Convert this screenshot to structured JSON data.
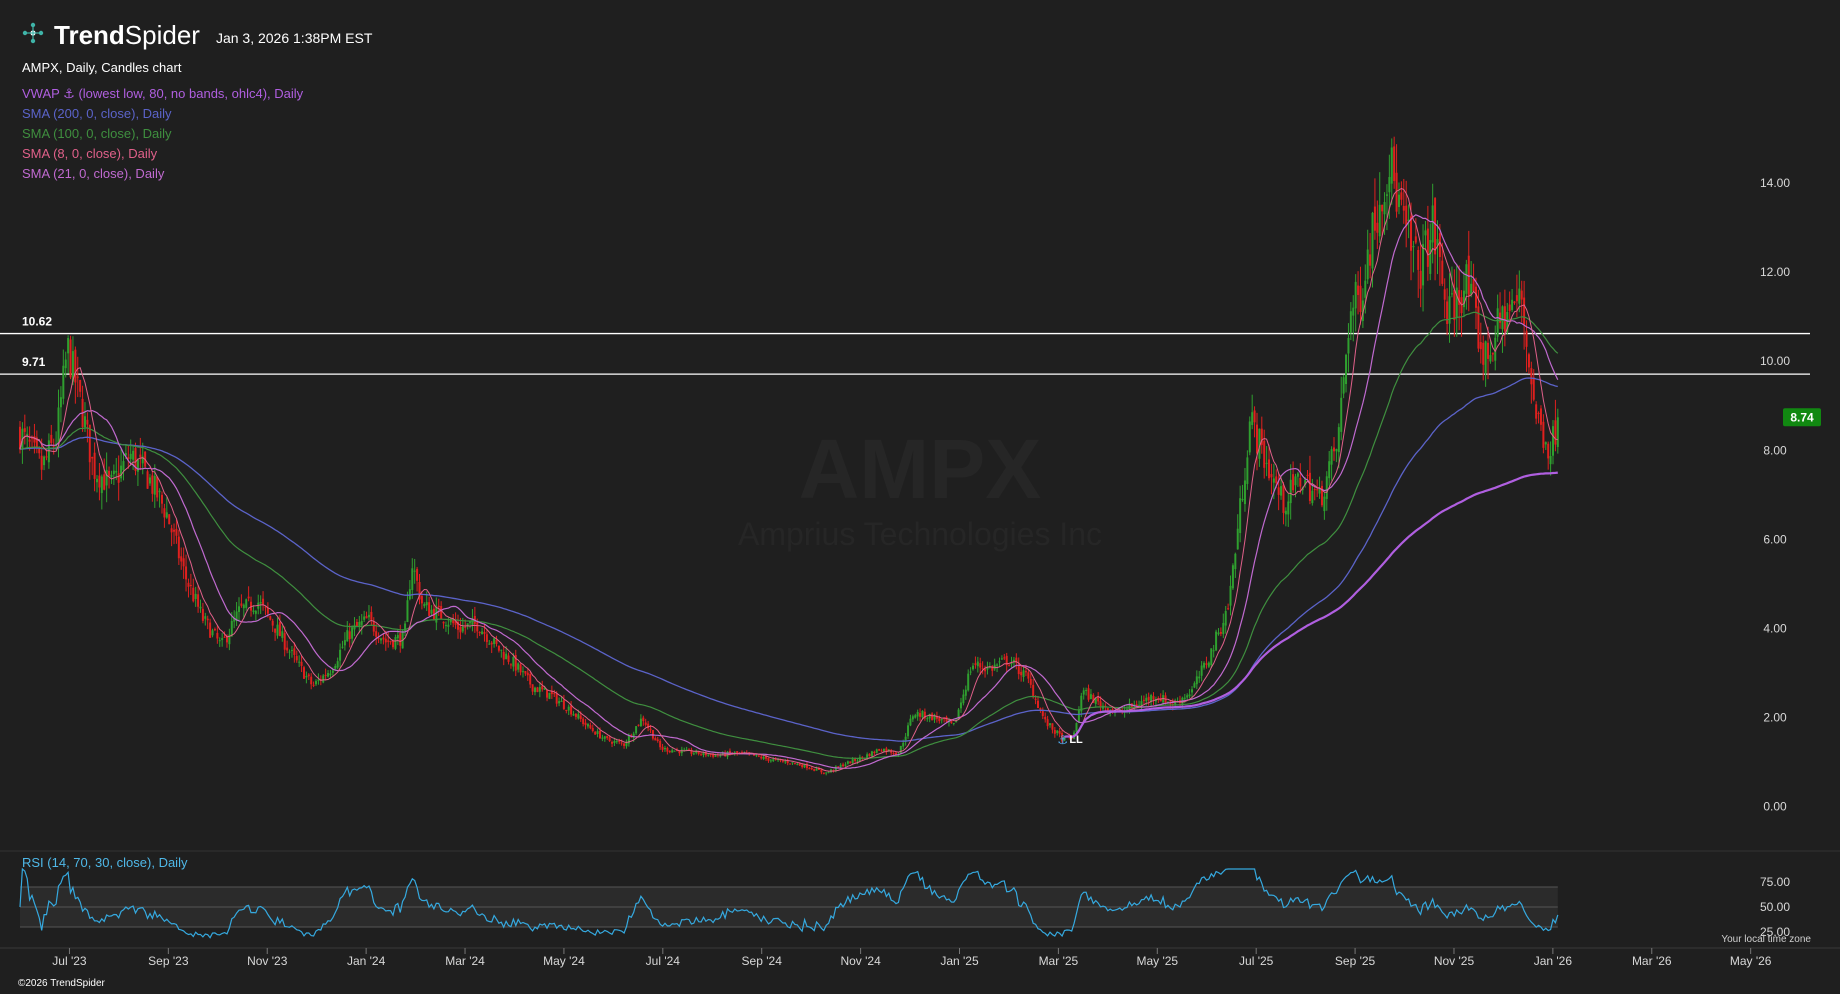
{
  "header": {
    "logo_text_bold": "Trend",
    "logo_text_regular": "Spider",
    "datetime": "Jan 3, 2026 1:38PM EST"
  },
  "chart_title": "AMPX, Daily, Candles chart",
  "indicators": [
    {
      "label": "VWAP ⚓ (lowest low, 80, no bands, ohlc4), Daily",
      "color": "#b05fe0"
    },
    {
      "label": "SMA (200, 0, close), Daily",
      "color": "#5b63c9"
    },
    {
      "label": "SMA (100, 0, close), Daily",
      "color": "#3f8f3f"
    },
    {
      "label": "SMA (8, 0, close), Daily",
      "color": "#e0608a"
    },
    {
      "label": "SMA (21, 0, close), Daily",
      "color": "#c06ad0"
    }
  ],
  "watermark": {
    "symbol": "AMPX",
    "company": "Amprius Technologies Inc"
  },
  "rsi_label": "RSI (14, 70, 30, close), Daily",
  "copyright": "©2026 TrendSpider",
  "timezone_note": "Your local time zone",
  "colors": {
    "background": "#1f1f1f",
    "up_candle": "#2fa02f",
    "down_candle": "#e0201e",
    "price_badge": "#118811",
    "rsi_line": "#35a9df"
  },
  "chart_data": {
    "type": "candlestick",
    "symbol": "AMPX",
    "interval": "Daily",
    "y_ticks": [
      "14.00",
      "12.00",
      "10.00",
      "8.00",
      "6.00",
      "4.00",
      "2.00",
      "0.00"
    ],
    "y_tick_values": [
      14,
      12,
      10,
      8,
      6,
      4,
      2,
      0
    ],
    "ylim": [
      -0.3,
      16.2
    ],
    "x_ticks": [
      "Jul '23",
      "Sep '23",
      "Nov '23",
      "Jan '24",
      "Mar '24",
      "May '24",
      "Jul '24",
      "Sep '24",
      "Nov '24",
      "Jan '25",
      "Mar '25",
      "May '25",
      "Jul '25",
      "Sep '25",
      "Nov '25",
      "Jan '26",
      "Mar '26",
      "May '26"
    ],
    "x_tick_months": [
      1,
      3,
      5,
      7,
      9,
      11,
      13,
      15,
      17,
      19,
      21,
      23,
      25,
      27,
      29,
      31,
      33,
      35
    ],
    "x_range_months": [
      0.0,
      36.2
    ],
    "last_data_month": 31.1,
    "horizontal_levels": [
      {
        "label": "10.62",
        "value": 10.62
      },
      {
        "label": "9.71",
        "value": 9.71
      }
    ],
    "last_price_label": "8.74",
    "last_price": 8.74,
    "anchor_label": "LL",
    "anchor_point": {
      "month": 21.1,
      "price": 1.52
    },
    "price_path": [
      [
        0.0,
        8.4
      ],
      [
        0.6,
        7.6
      ],
      [
        1.0,
        8.3
      ],
      [
        1.3,
        10.3
      ],
      [
        1.7,
        8.9
      ],
      [
        2.0,
        7.6
      ],
      [
        2.5,
        7.2
      ],
      [
        3.0,
        7.9
      ],
      [
        3.5,
        7.4
      ],
      [
        4.0,
        6.6
      ],
      [
        4.5,
        5.2
      ],
      [
        5.0,
        4.2
      ],
      [
        5.5,
        3.6
      ],
      [
        6.0,
        4.4
      ],
      [
        6.5,
        4.6
      ],
      [
        7.0,
        4.0
      ],
      [
        7.5,
        3.3
      ],
      [
        8.0,
        2.7
      ],
      [
        8.5,
        3.1
      ],
      [
        9.0,
        3.9
      ],
      [
        9.5,
        4.2
      ],
      [
        10.0,
        3.7
      ],
      [
        10.5,
        3.8
      ],
      [
        10.7,
        5.5
      ],
      [
        11.0,
        4.5
      ],
      [
        11.5,
        4.3
      ],
      [
        12.0,
        4.0
      ],
      [
        12.5,
        4.1
      ],
      [
        13.0,
        3.6
      ],
      [
        13.5,
        3.2
      ],
      [
        14.0,
        2.7
      ],
      [
        14.5,
        2.5
      ],
      [
        15.0,
        2.2
      ],
      [
        15.5,
        1.8
      ],
      [
        16.0,
        1.5
      ],
      [
        16.5,
        1.4
      ],
      [
        17.0,
        2.0
      ],
      [
        17.5,
        1.3
      ],
      [
        18.0,
        1.25
      ],
      [
        18.5,
        1.2
      ],
      [
        19.0,
        1.15
      ],
      [
        19.5,
        1.2
      ],
      [
        20.0,
        1.15
      ],
      [
        20.5,
        1.05
      ],
      [
        21.0,
        1.0
      ],
      [
        21.5,
        0.9
      ],
      [
        22.0,
        0.75
      ],
      [
        22.5,
        0.95
      ],
      [
        23.0,
        1.1
      ],
      [
        23.5,
        1.3
      ],
      [
        24.0,
        1.2
      ],
      [
        24.4,
        2.1
      ],
      [
        25.0,
        2.0
      ],
      [
        25.5,
        1.8
      ],
      [
        26.0,
        3.2
      ],
      [
        26.5,
        3.1
      ],
      [
        27.0,
        3.3
      ],
      [
        27.5,
        2.9
      ],
      [
        28.0,
        1.9
      ],
      [
        28.5,
        1.5
      ],
      [
        28.8,
        1.6
      ],
      [
        29.0,
        2.6
      ],
      [
        29.5,
        2.3
      ],
      [
        30.0,
        2.1
      ],
      [
        30.5,
        2.3
      ],
      [
        31.0,
        2.5
      ],
      [
        31.5,
        2.3
      ],
      [
        32.0,
        2.6
      ],
      [
        32.5,
        3.4
      ],
      [
        33.0,
        4.5
      ],
      [
        33.3,
        6.5
      ],
      [
        33.6,
        8.7
      ],
      [
        34.0,
        7.8
      ],
      [
        34.5,
        6.8
      ],
      [
        35.0,
        7.4
      ],
      [
        35.5,
        6.9
      ],
      [
        36.0,
        8.2
      ],
      [
        36.3,
        11.0
      ],
      [
        36.6,
        11.5
      ],
      [
        37.0,
        13.2
      ],
      [
        37.4,
        14.5
      ],
      [
        37.8,
        13.0
      ],
      [
        38.2,
        12.0
      ],
      [
        38.6,
        13.0
      ],
      [
        39.0,
        11.0
      ],
      [
        39.5,
        11.8
      ],
      [
        40.0,
        10.0
      ],
      [
        40.5,
        11.0
      ],
      [
        41.0,
        11.4
      ],
      [
        41.4,
        8.8
      ],
      [
        41.8,
        8.0
      ],
      [
        42.0,
        8.74
      ]
    ],
    "rsi": {
      "params": "RSI (14, 70, 30, close)",
      "y_ticks": [
        "75.00",
        "50.00",
        "25.00"
      ],
      "y_tick_values": [
        75,
        50,
        25
      ],
      "overbought": 70,
      "oversold": 30,
      "ylim": [
        12,
        92
      ]
    }
  }
}
